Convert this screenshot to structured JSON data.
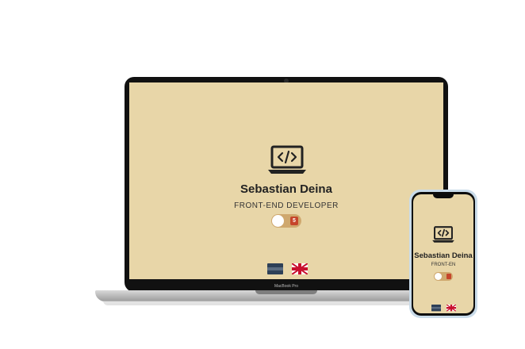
{
  "profile": {
    "name": "Sebastian Deina",
    "role": "FRONT-END DEVELOPER",
    "role_truncated": "FRONT-EN"
  },
  "device": {
    "laptop_label": "MacBook Pro"
  },
  "icons": {
    "code_laptop": "code-laptop-icon",
    "flag_spanish": "flag-es-icon",
    "flag_english": "flag-gb-icon"
  },
  "toggle": {
    "state": "off"
  },
  "colors": {
    "screen_background": "#e8d6a8",
    "text_primary": "#222222",
    "toggle_track": "#cfa86e",
    "toggle_badge": "#c6452b",
    "device_bezel": "#111111"
  }
}
